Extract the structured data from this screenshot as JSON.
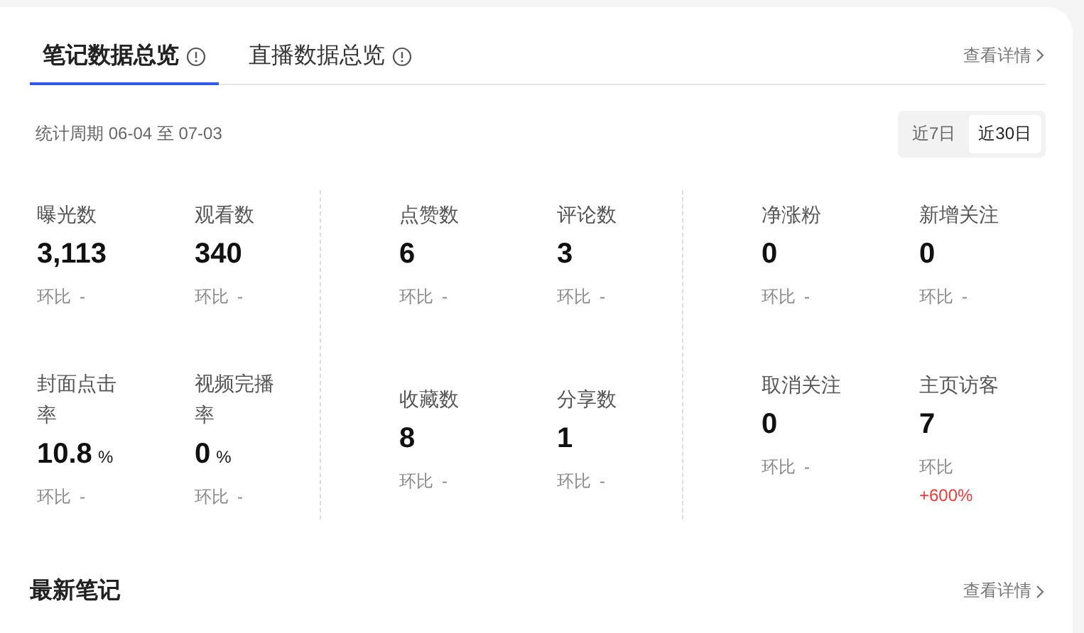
{
  "tabs": [
    {
      "label": "笔记数据总览",
      "selected": true
    },
    {
      "label": "直播数据总览",
      "selected": false
    }
  ],
  "details_link": "查看详情",
  "period": {
    "label": "统计周期",
    "range": "06-04 至 07-03"
  },
  "ranges": [
    {
      "label": "近7日",
      "selected": false
    },
    {
      "label": "近30日",
      "selected": true
    }
  ],
  "groups": [
    {
      "metrics": [
        {
          "label": "曝光数",
          "value": "3,113",
          "change_label": "环比",
          "change": "-",
          "rising": false
        },
        {
          "label": "观看数",
          "value": "340",
          "change_label": "环比",
          "change": "-",
          "rising": false
        },
        {
          "label": "封面点击率",
          "value": "10.8",
          "unit": "%",
          "change_label": "环比",
          "change": "-",
          "rising": false
        },
        {
          "label": "视频完播率",
          "value": "0",
          "unit": "%",
          "change_label": "环比",
          "change": "-",
          "rising": false
        }
      ]
    },
    {
      "metrics": [
        {
          "label": "点赞数",
          "value": "6",
          "change_label": "环比",
          "change": "-",
          "rising": false
        },
        {
          "label": "评论数",
          "value": "3",
          "change_label": "环比",
          "change": "-",
          "rising": false
        },
        {
          "label": "收藏数",
          "value": "8",
          "change_label": "环比",
          "change": "-",
          "rising": false
        },
        {
          "label": "分享数",
          "value": "1",
          "change_label": "环比",
          "change": "-",
          "rising": false
        }
      ]
    },
    {
      "metrics": [
        {
          "label": "净涨粉",
          "value": "0",
          "change_label": "环比",
          "change": "-",
          "rising": false
        },
        {
          "label": "新增关注",
          "value": "0",
          "change_label": "环比",
          "change": "-",
          "rising": false
        },
        {
          "label": "取消关注",
          "value": "0",
          "change_label": "环比",
          "change": "-",
          "rising": false
        },
        {
          "label": "主页访客",
          "value": "7",
          "change_label": "环比",
          "change": "+600%",
          "rising": true
        }
      ]
    }
  ],
  "latest": {
    "title": "最新笔记",
    "details_link": "查看详情"
  }
}
